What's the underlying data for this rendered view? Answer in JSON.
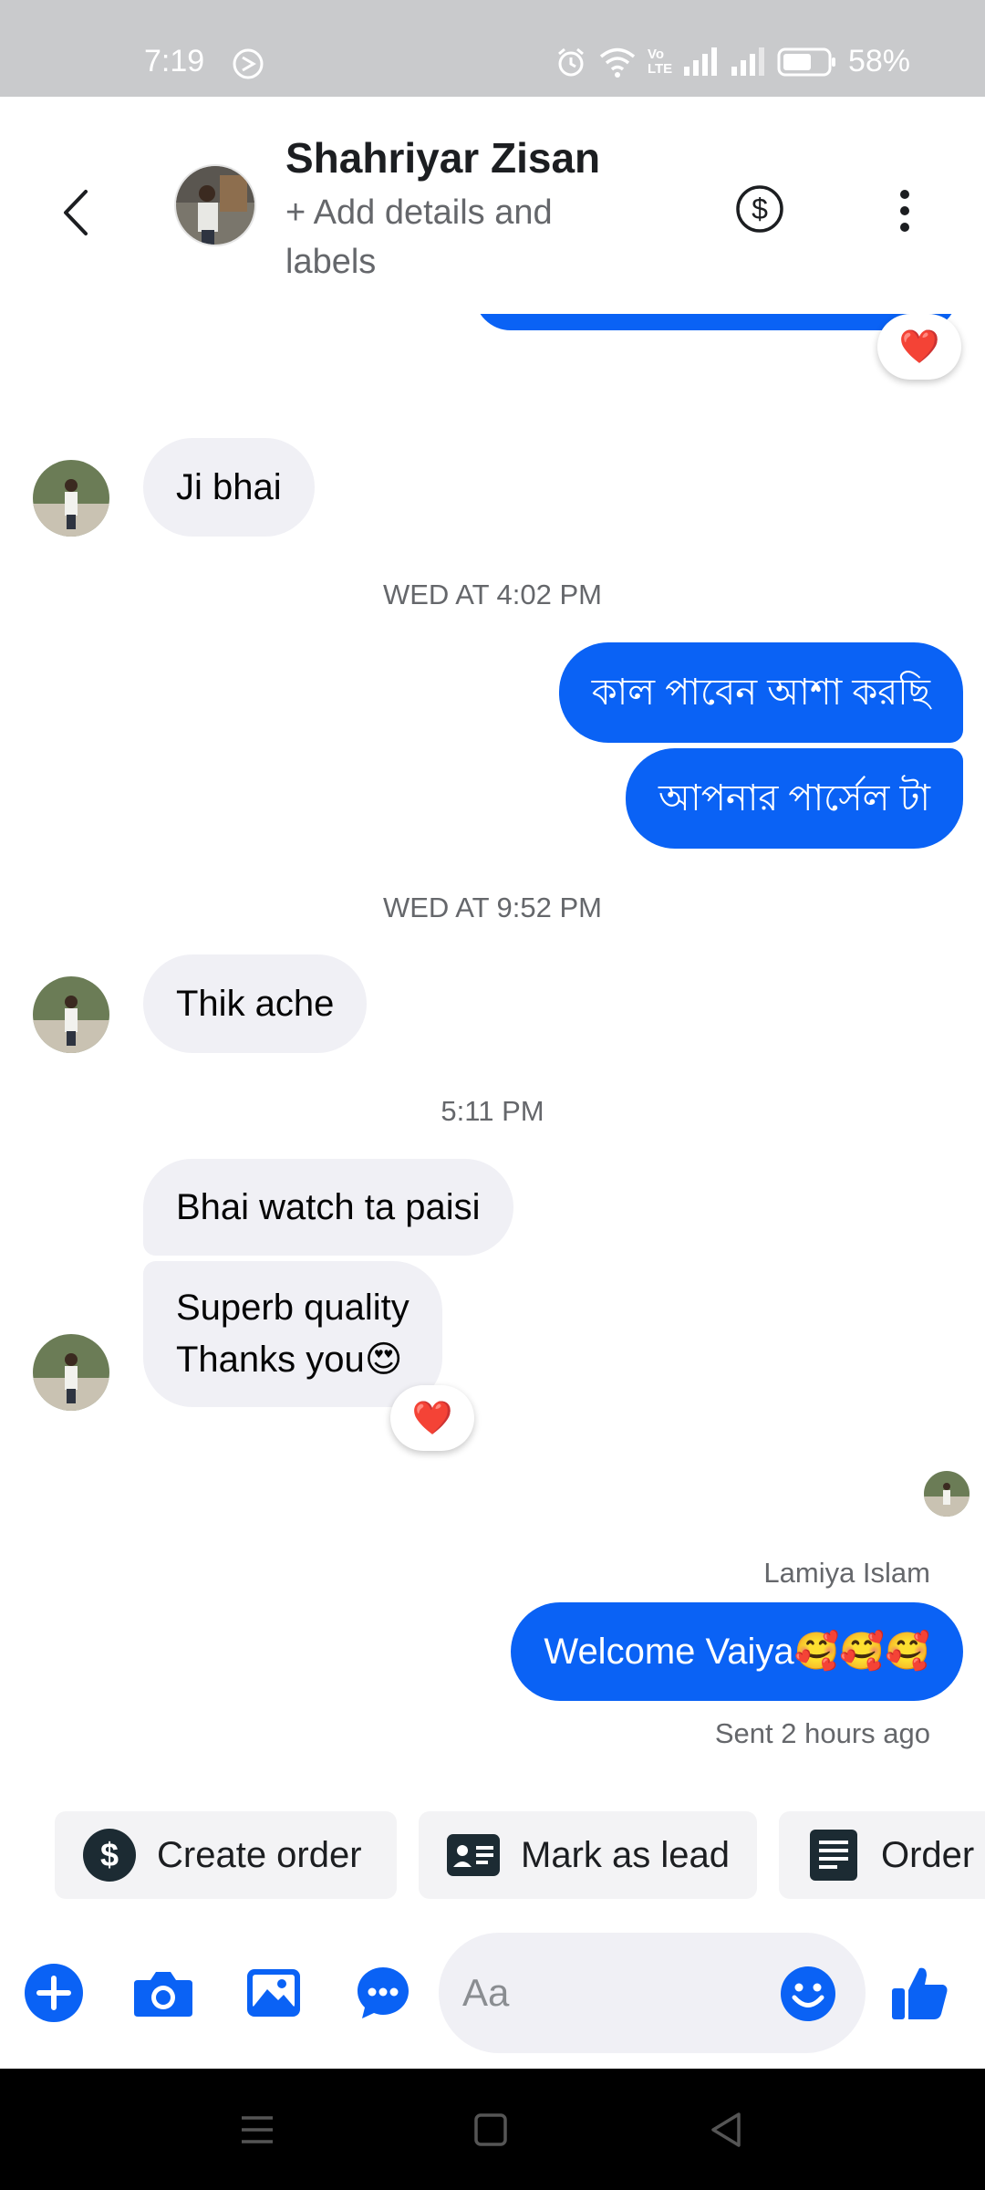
{
  "status_bar": {
    "time": "7:19",
    "battery": "58%",
    "network_label": "Vo LTE"
  },
  "header": {
    "contact_name": "Shahriyar Zisan",
    "subtitle": "+ Add details and labels"
  },
  "messages": {
    "m1": "Ji bhai",
    "ts1": "WED AT 4:02 PM",
    "m2": "কাল পাবেন আশা করছি",
    "m3": "আপনার পার্সেল টা",
    "ts2": "WED AT 9:52 PM",
    "m4": "Thik ache",
    "ts3": "5:11 PM",
    "m5": "Bhai watch ta paisi",
    "m6_line1": "Superb quality",
    "m6_line2": "Thanks you😍",
    "sender_name": "Lamiya Islam",
    "m7": "Welcome Vaiya🥰🥰🥰",
    "sent_status": "Sent 2 hours ago",
    "reaction": "❤️"
  },
  "quick_actions": {
    "create_order": "Create order",
    "mark_as_lead": "Mark as lead",
    "order": "Order"
  },
  "composer": {
    "placeholder": "Aa"
  },
  "colors": {
    "accent": "#0a62f5",
    "incoming_bubble": "#f0f0f5",
    "status_bar": "#c9cacc"
  }
}
